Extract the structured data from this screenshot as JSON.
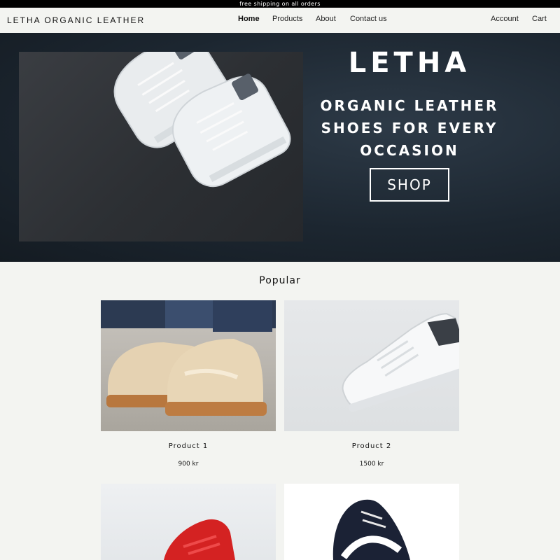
{
  "announcement": "free shipping on all orders",
  "header": {
    "brand": "LETHA ORGANIC LEATHER",
    "nav": [
      "Home",
      "Products",
      "About",
      "Contact us"
    ],
    "account": "Account",
    "cart": "Cart"
  },
  "hero": {
    "title": "LETHA",
    "subtitle": "ORGANIC LEATHER SHOES FOR EVERY OCCASION",
    "button": "SHOP"
  },
  "popular": {
    "title": "Popular",
    "products": [
      {
        "name": "Product 1",
        "price": "900 kr",
        "image_icon": "tan-high-top-sneakers-image"
      },
      {
        "name": "Product 2",
        "price": "1500 kr",
        "image_icon": "white-sneaker-image"
      },
      {
        "name": "",
        "price": "",
        "image_icon": "red-high-top-sneaker-image"
      },
      {
        "name": "",
        "price": "",
        "image_icon": "navy-puma-sneaker-image"
      }
    ]
  },
  "colors": {
    "topbar": "#000000",
    "background": "#f3f4f1",
    "hero": "#1c2630"
  }
}
